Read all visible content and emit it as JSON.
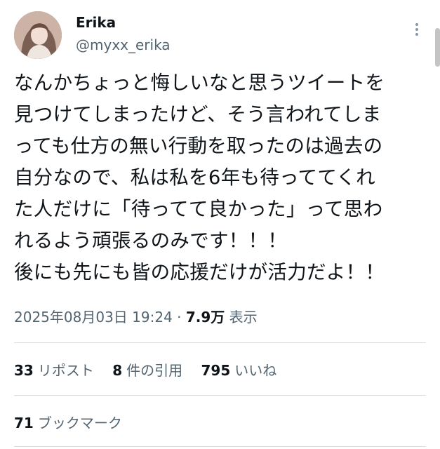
{
  "author": {
    "display_name": "Erika",
    "handle": "@myxx_erika"
  },
  "tweet": {
    "text": "なんかちょっと悔しいなと思うツイートを\n見つけてしまったけど、そう言われてしま\nっても仕方の無い行動を取ったのは過去の\n自分なので、私は私を6年も待っててくれ\nた人だけに「待ってて良かった」って思わ\nれるよう頑張るのみです！！！\n後にも先にも皆の応援だけが活力だよ！！"
  },
  "meta": {
    "timestamp": "2025年08月03日 19:24",
    "separator": "·",
    "views_count": "7.9万",
    "views_label": "表示"
  },
  "stats": {
    "reposts": {
      "count": "33",
      "label": "リポスト"
    },
    "quotes": {
      "count": "8",
      "label": "件の引用"
    },
    "likes": {
      "count": "795",
      "label": "いいね"
    },
    "bookmarks": {
      "count": "71",
      "label": "ブックマーク"
    }
  },
  "icons": {
    "more": "more-vertical-icon",
    "avatar": "profile-avatar"
  },
  "colors": {
    "text_primary": "#0f1419",
    "text_secondary": "#536471",
    "divider": "#dcdcdc"
  }
}
